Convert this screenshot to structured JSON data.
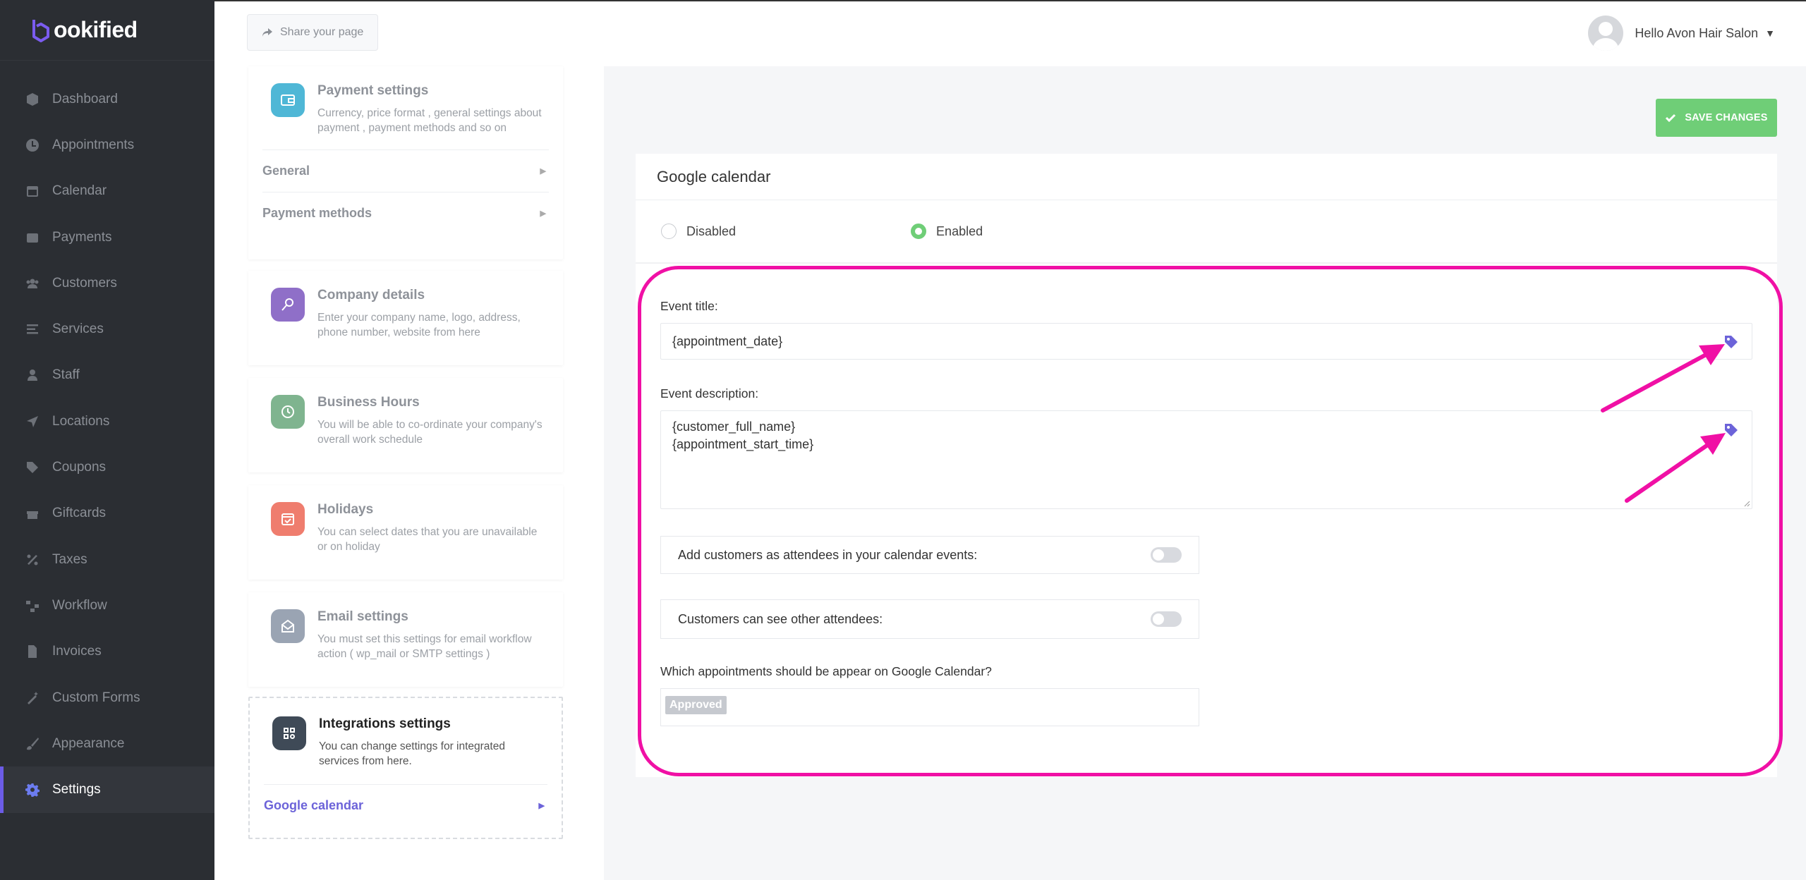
{
  "brand": {
    "logo_text": "ookified",
    "accent": "#6c5ce7"
  },
  "sidebar": {
    "items": [
      {
        "label": "Dashboard",
        "icon": "cube-icon"
      },
      {
        "label": "Appointments",
        "icon": "clock-icon"
      },
      {
        "label": "Calendar",
        "icon": "calendar-icon"
      },
      {
        "label": "Payments",
        "icon": "wallet-icon"
      },
      {
        "label": "Customers",
        "icon": "users-icon"
      },
      {
        "label": "Services",
        "icon": "list-icon"
      },
      {
        "label": "Staff",
        "icon": "user-icon"
      },
      {
        "label": "Locations",
        "icon": "location-arrow-icon"
      },
      {
        "label": "Coupons",
        "icon": "tag-icon"
      },
      {
        "label": "Giftcards",
        "icon": "gift-icon"
      },
      {
        "label": "Taxes",
        "icon": "percent-icon"
      },
      {
        "label": "Workflow",
        "icon": "workflow-icon"
      },
      {
        "label": "Invoices",
        "icon": "file-icon"
      },
      {
        "label": "Custom Forms",
        "icon": "magic-icon"
      },
      {
        "label": "Appearance",
        "icon": "brush-icon"
      },
      {
        "label": "Settings",
        "icon": "gear-icon",
        "active": true
      }
    ]
  },
  "topbar": {
    "share_label": "Share your page",
    "user_greeting": "Hello Avon Hair Salon"
  },
  "settings_cards": {
    "payment": {
      "title": "Payment settings",
      "desc": "Currency, price format , general settings about payment , payment methods and so on",
      "sub": [
        "General",
        "Payment methods"
      ],
      "color": "#4fb7d6"
    },
    "company": {
      "title": "Company details",
      "desc": "Enter your company name, logo, address, phone number, website from here",
      "color": "#8f6fc8"
    },
    "hours": {
      "title": "Business Hours",
      "desc": "You will be able to co-ordinate your company's overall work schedule",
      "color": "#7fb48f"
    },
    "holidays": {
      "title": "Holidays",
      "desc": "You can select dates that you are unavailable or on holiday",
      "color": "#ef7d6e"
    },
    "email": {
      "title": "Email settings",
      "desc": "You must set this settings for email workflow action ( wp_mail or SMTP settings )",
      "color": "#9aa4b3"
    },
    "integrations": {
      "title": "Integrations settings",
      "desc": "You can change settings for integrated services from here.",
      "sub": [
        "Google calendar"
      ],
      "color": "#3f4a57"
    }
  },
  "main": {
    "save_label": "SAVE CHANGES",
    "panel_title": "Google calendar",
    "radio_disabled": "Disabled",
    "radio_enabled": "Enabled",
    "enabled": true,
    "event_title_label": "Event title:",
    "event_title_value": "{appointment_date}",
    "event_desc_label": "Event description:",
    "event_desc_line1": "{customer_full_name}",
    "event_desc_line2": "{appointment_start_time}",
    "attendees_label": "Add customers as attendees in your calendar events:",
    "see_attendees_label": "Customers can see other attendees:",
    "appointments_question": "Which appointments should be appear on Google Calendar?",
    "status_chip": "Approved"
  },
  "colors": {
    "highlight": "#f010a5",
    "save": "#6fce77",
    "sidebar_bg": "#2b2e33"
  }
}
